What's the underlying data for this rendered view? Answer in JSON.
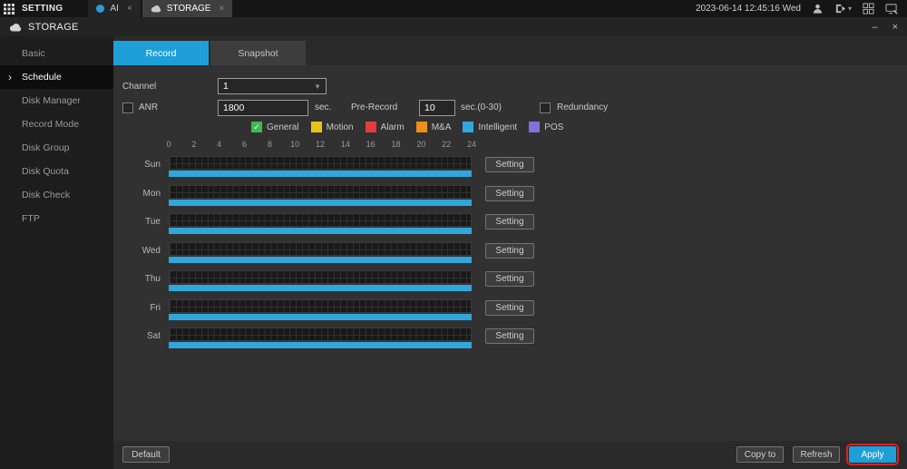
{
  "taskbar": {
    "setting": "SETTING",
    "tabs": [
      {
        "label": "AI",
        "close": "×"
      },
      {
        "label": "STORAGE",
        "close": "×"
      }
    ],
    "datetime": "2023-06-14 12:45:16 Wed"
  },
  "titlebar": {
    "title": "STORAGE",
    "minimize": "–",
    "close": "×"
  },
  "sidebar": {
    "items": [
      "Basic",
      "Schedule",
      "Disk Manager",
      "Record Mode",
      "Disk Group",
      "Disk Quota",
      "Disk Check",
      "FTP"
    ],
    "selected": "Schedule"
  },
  "content": {
    "tabs": [
      {
        "label": "Record",
        "active": true
      },
      {
        "label": "Snapshot",
        "active": false
      }
    ],
    "channel": {
      "label": "Channel",
      "value": "1"
    },
    "anr": {
      "label": "ANR",
      "value": "1800",
      "unit": "sec.",
      "checked": false
    },
    "pre_record": {
      "label": "Pre-Record",
      "value": "10",
      "unit": "sec.(0-30)"
    },
    "redundancy": {
      "label": "Redundancy",
      "checked": false
    },
    "legend": [
      {
        "label": "General",
        "color": "#3fb954",
        "checked": true
      },
      {
        "label": "Motion",
        "color": "#e8c41c",
        "checked": false
      },
      {
        "label": "Alarm",
        "color": "#e23c3c",
        "checked": false
      },
      {
        "label": "M&A",
        "color": "#ef8e1b",
        "checked": false
      },
      {
        "label": "Intelligent",
        "color": "#2fa7dc",
        "checked": false
      },
      {
        "label": "POS",
        "color": "#8470d8",
        "checked": false
      }
    ],
    "schedule": {
      "hours": [
        "0",
        "2",
        "4",
        "6",
        "8",
        "10",
        "12",
        "14",
        "16",
        "18",
        "20",
        "22",
        "24"
      ],
      "days": [
        "Sun",
        "Mon",
        "Tue",
        "Wed",
        "Thu",
        "Fri",
        "Sat"
      ],
      "setting_label": "Setting"
    }
  },
  "footer": {
    "default": "Default",
    "copy_to": "Copy to",
    "refresh": "Refresh",
    "apply": "Apply"
  },
  "colors": {
    "accent_blue": "#1e9fd8",
    "schedule_bar": "#2fa7dc",
    "apply_highlight_red": "#e02020"
  }
}
